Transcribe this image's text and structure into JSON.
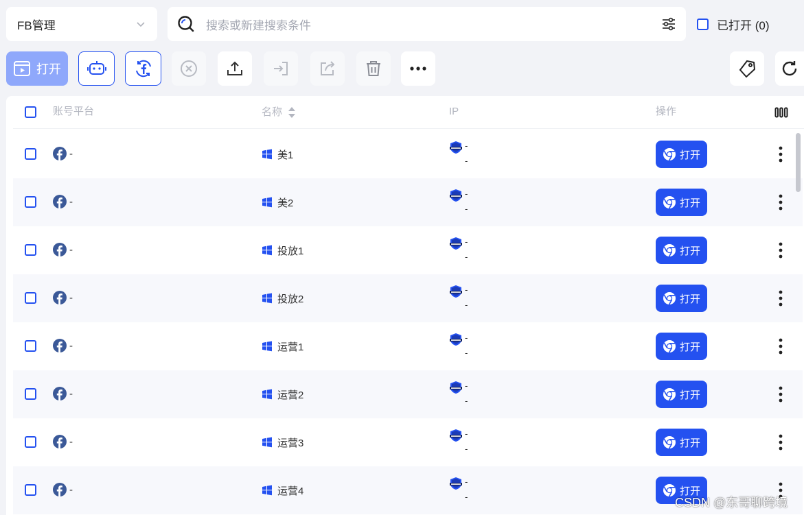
{
  "group_select": {
    "value": "FB管理"
  },
  "search": {
    "placeholder": "搜索或新建搜索条件"
  },
  "opened_filter": {
    "label": "已打开 (0)"
  },
  "toolbar": {
    "open_label": "打开"
  },
  "table": {
    "columns": {
      "platform": "账号平台",
      "name": "名称",
      "ip": "IP",
      "actions": "操作"
    },
    "rows": [
      {
        "platform": "-",
        "name": "美1",
        "ip_line1": "-",
        "ip_line2": "-",
        "action": "打开"
      },
      {
        "platform": "-",
        "name": "美2",
        "ip_line1": "-",
        "ip_line2": "-",
        "action": "打开"
      },
      {
        "platform": "-",
        "name": "投放1",
        "ip_line1": "-",
        "ip_line2": "-",
        "action": "打开"
      },
      {
        "platform": "-",
        "name": "投放2",
        "ip_line1": "-",
        "ip_line2": "-",
        "action": "打开"
      },
      {
        "platform": "-",
        "name": "运营1",
        "ip_line1": "-",
        "ip_line2": "-",
        "action": "打开"
      },
      {
        "platform": "-",
        "name": "运营2",
        "ip_line1": "-",
        "ip_line2": "-",
        "action": "打开"
      },
      {
        "platform": "-",
        "name": "运营3",
        "ip_line1": "-",
        "ip_line2": "-",
        "action": "打开"
      },
      {
        "platform": "-",
        "name": "运营4",
        "ip_line1": "-",
        "ip_line2": "-",
        "action": "打开"
      }
    ]
  },
  "watermark": "CSDN @东哥聊跨境",
  "colors": {
    "accent": "#2451f0",
    "accent_light": "#8fa8fb",
    "row_alt": "#f7f8fc",
    "background": "#f2f3f7"
  }
}
